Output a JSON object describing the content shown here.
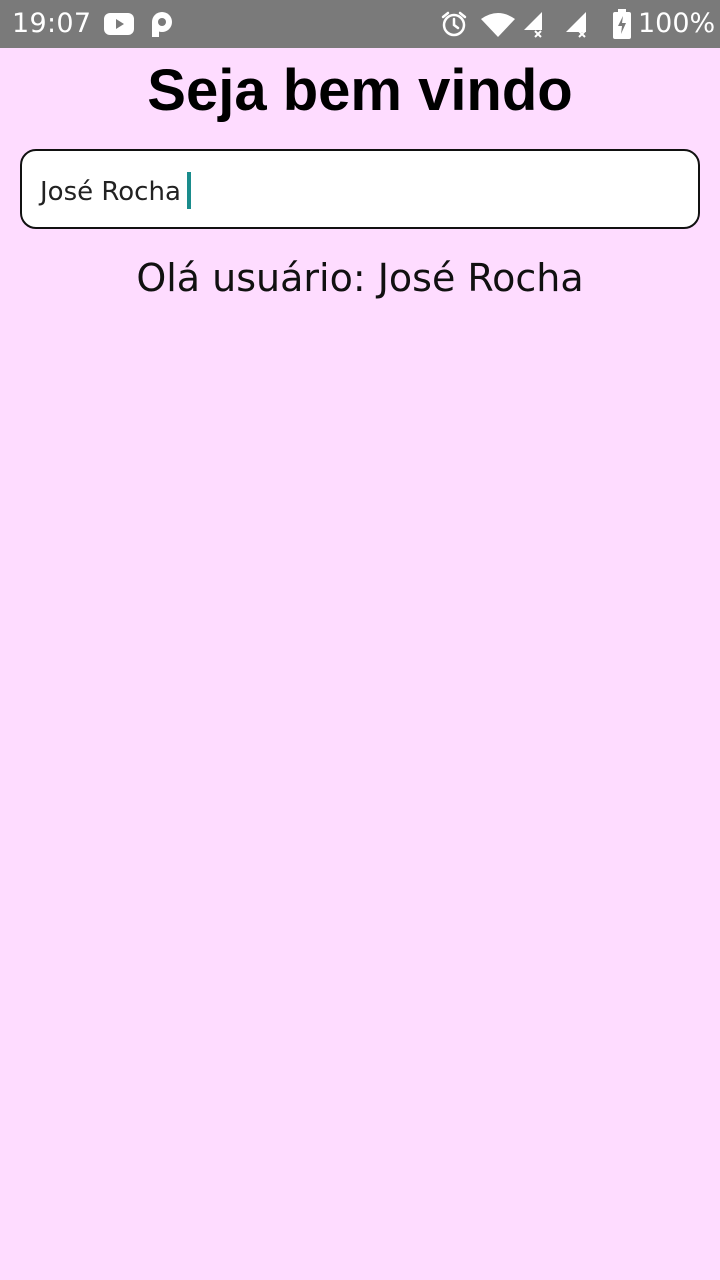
{
  "status_bar": {
    "time": "19:07",
    "battery": "100%",
    "icons": [
      "youtube-icon",
      "p-notification-icon",
      "alarm-icon",
      "wifi-icon",
      "signal-icon",
      "signal-icon-2",
      "battery-icon"
    ]
  },
  "app": {
    "title": "Seja bem vindo",
    "input": {
      "value": "José Rocha"
    },
    "greeting": "Olá usuário: José Rocha"
  },
  "colors": {
    "background": "#FEDCFF",
    "status_bar": "#7A7A7A",
    "caret": "#1A8C8C"
  }
}
